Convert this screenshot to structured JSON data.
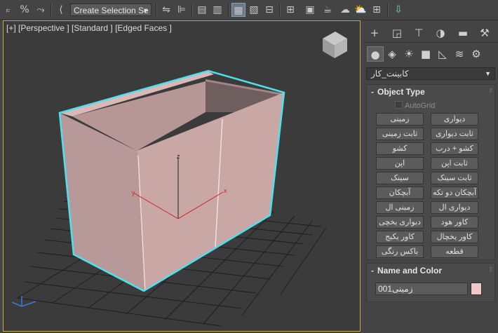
{
  "toolbar": {
    "selection_set_label": "Create Selection Se",
    "icons": [
      "link-icon",
      "unlink-icon",
      "bind-space-warp-icon",
      "selection-filter-icon",
      "mirror-icon",
      "align-icon",
      "layer-explorer-icon",
      "ribbon-toggle-icon",
      "curve-editor-icon",
      "schematic-view-icon",
      "material-editor-icon",
      "render-setup-icon",
      "rendered-frame-icon",
      "render-icon",
      "render-production-icon",
      "render-cloud-icon",
      "viewport-layout-icon",
      "download-icon"
    ]
  },
  "viewport": {
    "label": "[+] [Perspective ] [Standard ] [Edged Faces ]",
    "axis_labels": {
      "x": "x",
      "y": "y",
      "z": "z"
    }
  },
  "panel": {
    "tabs": [
      "create-tab",
      "modify-tab",
      "hierarchy-tab",
      "motion-tab",
      "display-tab",
      "utilities-tab"
    ],
    "subtabs": [
      "geometry-icon",
      "shapes-icon",
      "lights-icon",
      "cameras-icon",
      "helpers-icon",
      "spacewarps-icon",
      "systems-icon"
    ],
    "category": "کابینت_کار",
    "object_type": {
      "header": "Object Type",
      "sign": "-",
      "autogrid": "AutoGrid",
      "buttons": [
        "دیواری",
        "زمینی",
        "ثابت دیواری",
        "ثابت زمینی",
        "کشو + درب",
        "کشو",
        "ثابت اپن",
        "اپن",
        "ثابت سینک",
        "سینک",
        "آبچکان دو تکه",
        "آبچکان",
        "دیواری ال",
        "زمینی ال",
        "کاور هود",
        "دیواری یخچی",
        "کاور یخچال",
        "کاور یکیج",
        "قطعه",
        "باکس رنگی"
      ]
    },
    "name_and_color": {
      "header": "Name and Color",
      "sign": "-",
      "name": "زمینی001",
      "color": "#f0c8c8"
    }
  },
  "colors": {
    "selection_outline": "#4fe0f0",
    "box_fill": "#c9a9a6",
    "viewport_border": "#c8a94a",
    "x_axis": "#d02020",
    "y_axis": "#d02020",
    "z_axis": "#222222"
  }
}
